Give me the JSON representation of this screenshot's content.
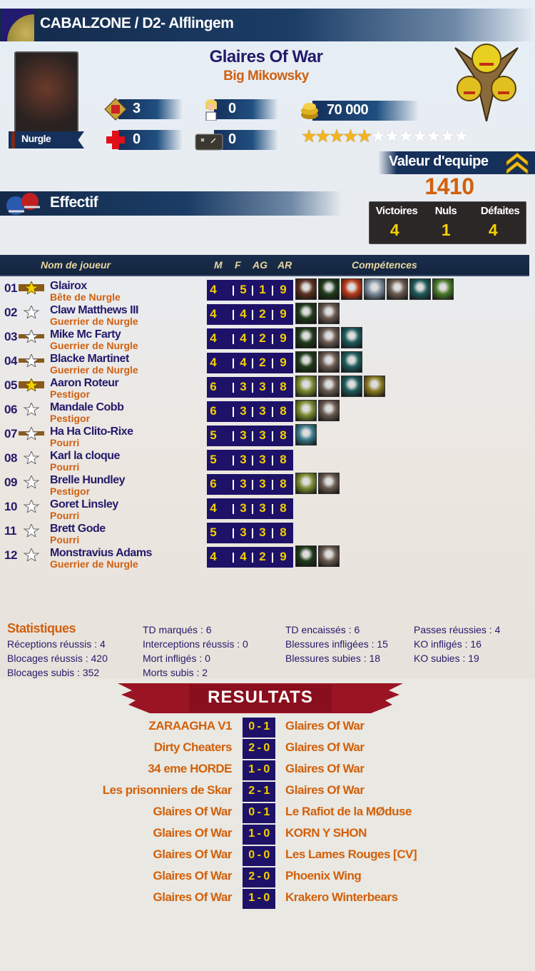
{
  "header": {
    "title": "CABALZONE / D2- Alflingem"
  },
  "team": {
    "name": "Glaires Of War",
    "coach": "Big Mikowsky",
    "race": "Nurgle",
    "rerolls": "3",
    "cheerleaders": "0",
    "apothecary": "0",
    "assistant_coaches": "0",
    "treasury": "70 000",
    "popularity": {
      "value": 5,
      "max": 12
    },
    "team_value_label": "Valeur d'equipe",
    "team_value": "1410",
    "section_title": "Effectif",
    "record": {
      "wins_label": "Victoires",
      "draws_label": "Nuls",
      "losses_label": "Défaites",
      "wins": "4",
      "draws": "1",
      "losses": "4"
    }
  },
  "colors": {
    "navy": "#231a6a",
    "orange": "#d06010",
    "stat_bg": "#1d1268",
    "stat_text": "#f5d000"
  },
  "roster_header": {
    "name": "Nom de joueur",
    "m": "M",
    "f": "F",
    "ag": "AG",
    "ar": "AR",
    "skills": "Compétences"
  },
  "players": [
    {
      "num": "01",
      "badge": "gold",
      "name": "Glairox",
      "position": "Bête de Nurgle",
      "m": "4",
      "f": "5",
      "ag": "1",
      "ar": "9",
      "skills": [
        "dark-figure",
        "green-helmet",
        "red-fighter",
        "horse",
        "helmet-face",
        "teal-hand",
        "green-claw"
      ]
    },
    {
      "num": "02",
      "badge": "star",
      "name": "Claw Matthews III",
      "position": "Guerrier de Nurgle",
      "m": "4",
      "f": "4",
      "ag": "2",
      "ar": "9",
      "skills": [
        "green-helmet",
        "helmet-face"
      ]
    },
    {
      "num": "03",
      "badge": "silver",
      "name": "Mike Mc Farty",
      "position": "Guerrier de Nurgle",
      "m": "4",
      "f": "4",
      "ag": "2",
      "ar": "9",
      "skills": [
        "green-helmet",
        "helmet-face",
        "teal-hand"
      ]
    },
    {
      "num": "04",
      "badge": "silver",
      "name": "Blacke Martinet",
      "position": "Guerrier de Nurgle",
      "m": "4",
      "f": "4",
      "ag": "2",
      "ar": "9",
      "skills": [
        "green-helmet",
        "helmet-face",
        "teal-hand"
      ]
    },
    {
      "num": "05",
      "badge": "gold",
      "name": "Aaron Roteur",
      "position": "Pestigor",
      "m": "6",
      "f": "3",
      "ag": "3",
      "ar": "8",
      "skills": [
        "ram-horn",
        "helmet-face",
        "teal-hand",
        "gold-axe"
      ]
    },
    {
      "num": "06",
      "badge": "star",
      "name": "Mandale Cobb",
      "position": "Pestigor",
      "m": "6",
      "f": "3",
      "ag": "3",
      "ar": "8",
      "skills": [
        "ram-horn",
        "helmet-face"
      ]
    },
    {
      "num": "07",
      "badge": "silver",
      "name": "Ha Ha Clito-Rixe",
      "position": "Pourri",
      "m": "5",
      "f": "3",
      "ag": "3",
      "ar": "8",
      "skills": [
        "arm-grip"
      ]
    },
    {
      "num": "08",
      "badge": "star",
      "name": "Karl la cloque",
      "position": "Pourri",
      "m": "5",
      "f": "3",
      "ag": "3",
      "ar": "8",
      "skills": []
    },
    {
      "num": "09",
      "badge": "star",
      "name": "Brelle Hundley",
      "position": "Pestigor",
      "m": "6",
      "f": "3",
      "ag": "3",
      "ar": "8",
      "skills": [
        "ram-horn",
        "helmet-face"
      ]
    },
    {
      "num": "10",
      "badge": "star",
      "name": "Goret Linsley",
      "position": "Pourri",
      "m": "4",
      "f": "3",
      "ag": "3",
      "ar": "8",
      "skills": []
    },
    {
      "num": "11",
      "badge": "star",
      "name": "Brett Gode",
      "position": "Pourri",
      "m": "5",
      "f": "3",
      "ag": "3",
      "ar": "8",
      "skills": []
    },
    {
      "num": "12",
      "badge": "star",
      "name": "Monstravius Adams",
      "position": "Guerrier de Nurgle",
      "m": "4",
      "f": "4",
      "ag": "2",
      "ar": "9",
      "skills": [
        "green-helmet",
        "helmet-face"
      ]
    }
  ],
  "stats": {
    "title": "Statistiques",
    "items": [
      "TD marqués : 6",
      "TD encaissés : 6",
      "Passes réussies : 4",
      "Réceptions réussis : 4",
      "Interceptions réussis : 0",
      "Blessures infligées : 15",
      "KO infligés : 16",
      "Blocages réussis : 420",
      "Mort infligés : 0",
      "Blessures subies : 18",
      "KO subies : 19",
      "Blocages subis : 352",
      "Morts subis : 2"
    ]
  },
  "results": {
    "title": "RESULTATS",
    "matches": [
      {
        "home": "ZARAAGHA V1",
        "score": "0 - 1",
        "away": "Glaires Of War"
      },
      {
        "home": "Dirty Cheaters",
        "score": "2 - 0",
        "away": "Glaires Of War"
      },
      {
        "home": "34 eme HORDE",
        "score": "1 - 0",
        "away": "Glaires Of War"
      },
      {
        "home": "Les prisonniers de Skar",
        "score": "2 - 1",
        "away": "Glaires Of War"
      },
      {
        "home": "Glaires Of War",
        "score": "0 - 1",
        "away": "Le Rafiot de la MØduse"
      },
      {
        "home": "Glaires Of War",
        "score": "1 - 0",
        "away": "KORN Y SHON"
      },
      {
        "home": "Glaires Of War",
        "score": "0 - 0",
        "away": "Les Lames Rouges [CV]"
      },
      {
        "home": "Glaires Of War",
        "score": "2 - 0",
        "away": "Phoenix Wing"
      },
      {
        "home": "Glaires Of War",
        "score": "1 - 0",
        "away": "Krakero Winterbears"
      }
    ]
  }
}
